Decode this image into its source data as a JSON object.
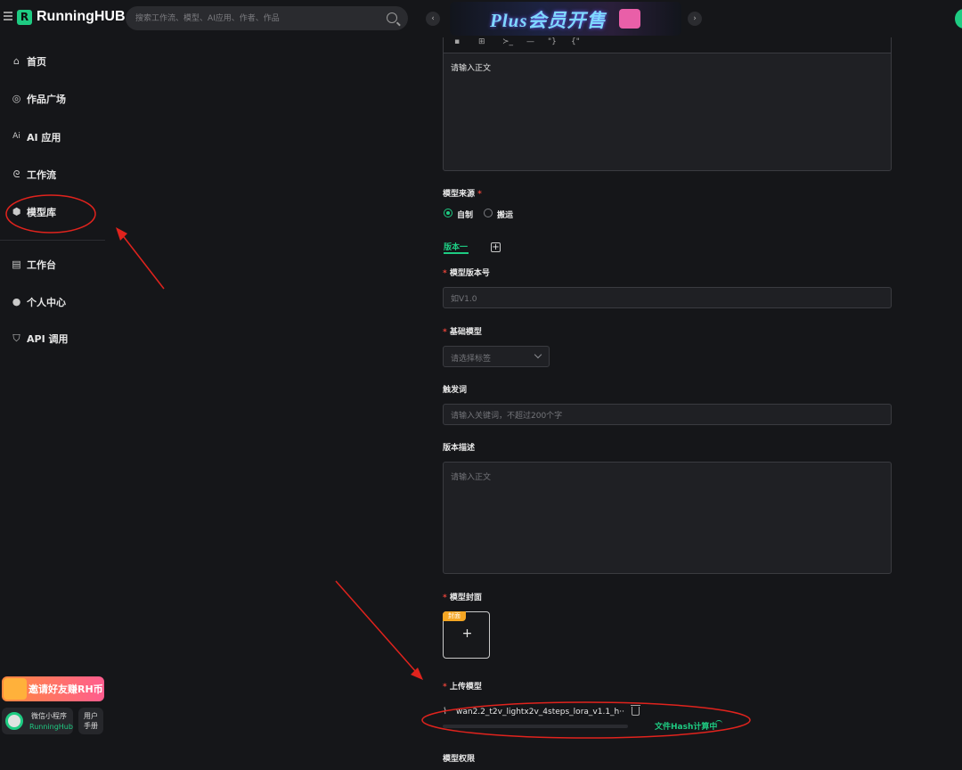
{
  "header": {
    "logo_letter": "R",
    "brand": "RunningHUB",
    "search_placeholder": "搜索工作流、模型、AI应用、作者、作品",
    "banner_text": "Plus会员开售"
  },
  "sidebar": {
    "items": [
      {
        "label": "首页",
        "icon": "home-icon"
      },
      {
        "label": "作品广场",
        "icon": "location-pin-icon"
      },
      {
        "label": "AI 应用",
        "icon": "ai-icon"
      },
      {
        "label": "工作流",
        "icon": "workflow-icon"
      },
      {
        "label": "模型库",
        "icon": "cube-icon",
        "highlighted": true
      },
      {
        "label": "工作台",
        "icon": "workbench-icon"
      },
      {
        "label": "个人中心",
        "icon": "user-icon"
      },
      {
        "label": "API 调用",
        "icon": "shield-icon"
      }
    ],
    "invite_label": "邀请好友赚RH币",
    "mini_program_label": "微信小程序",
    "mini_program_sub": "RunningHub",
    "manual_label_1": "用户",
    "manual_label_2": "手册"
  },
  "form": {
    "editor_placeholder": "请输入正文",
    "source_label": "模型来源",
    "source_options": [
      {
        "label": "自制",
        "selected": true
      },
      {
        "label": "搬运",
        "selected": false
      }
    ],
    "version_tab": "版本一",
    "version_number_label": "模型版本号",
    "version_number_placeholder": "如V1.0",
    "base_model_label": "基础模型",
    "base_model_placeholder": "请选择标签",
    "trigger_label": "触发词",
    "trigger_placeholder": "请输入关键词，不超过200个字",
    "version_desc_label": "版本描述",
    "version_desc_placeholder": "请输入正文",
    "cover_label": "模型封面",
    "cover_tag": "封面",
    "cover_plus": "+",
    "upload_label": "上传模型",
    "file_name": "wan2.2_t2v_lightx2v_4steps_lora_v1.1_h···",
    "upload_progress": 0,
    "hash_status": "文件Hash计算中",
    "permission_label": "模型权限"
  },
  "colors": {
    "accent": "#1ecb82",
    "annotation": "#e0231d",
    "required": "#e8443a"
  }
}
